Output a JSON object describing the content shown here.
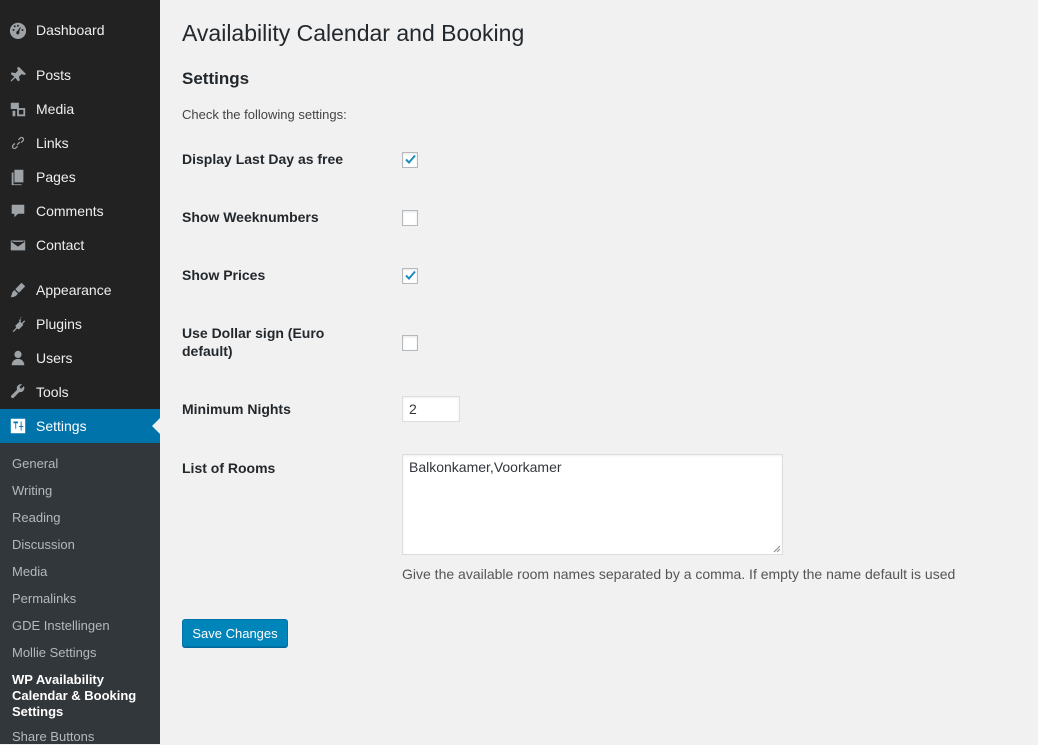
{
  "sidebar": {
    "items": [
      {
        "label": "Dashboard",
        "icon": "dashboard-icon"
      },
      {
        "label": "Posts",
        "icon": "pin-icon"
      },
      {
        "label": "Media",
        "icon": "media-icon"
      },
      {
        "label": "Links",
        "icon": "link-icon"
      },
      {
        "label": "Pages",
        "icon": "pages-icon"
      },
      {
        "label": "Comments",
        "icon": "comment-icon"
      },
      {
        "label": "Contact",
        "icon": "mail-icon"
      },
      {
        "label": "Appearance",
        "icon": "brush-icon"
      },
      {
        "label": "Plugins",
        "icon": "plug-icon"
      },
      {
        "label": "Users",
        "icon": "user-icon"
      },
      {
        "label": "Tools",
        "icon": "wrench-icon"
      },
      {
        "label": "Settings",
        "icon": "settings-icon",
        "active": true
      }
    ],
    "submenu": [
      {
        "label": "General"
      },
      {
        "label": "Writing"
      },
      {
        "label": "Reading"
      },
      {
        "label": "Discussion"
      },
      {
        "label": "Media"
      },
      {
        "label": "Permalinks"
      },
      {
        "label": "GDE Instellingen"
      },
      {
        "label": "Mollie Settings"
      },
      {
        "label": "WP Availability Calendar & Booking Settings",
        "current": true
      },
      {
        "label": "Share Buttons"
      }
    ]
  },
  "page": {
    "title": "Availability Calendar and Booking",
    "section_title": "Settings",
    "intro": "Check the following settings:"
  },
  "settings": {
    "display_last_day": {
      "label": "Display Last Day as free",
      "checked": true
    },
    "show_weeknumbers": {
      "label": "Show Weeknumbers",
      "checked": false
    },
    "show_prices": {
      "label": "Show Prices",
      "checked": true
    },
    "use_dollar": {
      "label": "Use Dollar sign (Euro default)",
      "checked": false
    },
    "minimum_nights": {
      "label": "Minimum Nights",
      "value": "2"
    },
    "list_of_rooms": {
      "label": "List of Rooms",
      "value": "Balkonkamer,Voorkamer",
      "help": "Give the available room names separated by a comma. If empty the name default is used"
    }
  },
  "buttons": {
    "save_label": "Save Changes"
  },
  "colors": {
    "accent": "#0073aa",
    "button": "#0085ba",
    "sidebar_bg": "#222222",
    "submenu_bg": "#32373c",
    "check": "#1e8cbe"
  }
}
